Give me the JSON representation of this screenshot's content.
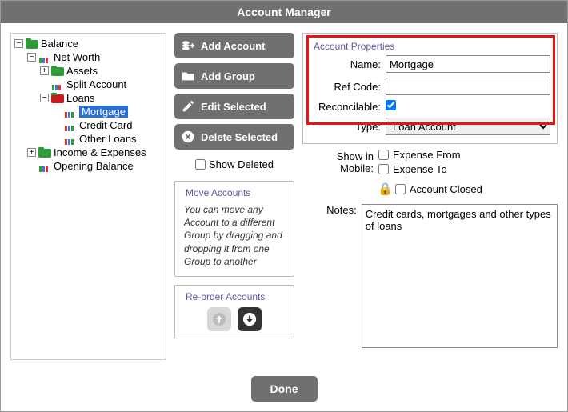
{
  "title": "Account Manager",
  "tree": {
    "root": "Balance",
    "netWorth": "Net Worth",
    "assets": "Assets",
    "splitAccount": "Split Account",
    "loans": "Loans",
    "mortgage": "Mortgage",
    "creditCard": "Credit Card",
    "otherLoans": "Other Loans",
    "incomeExpenses": "Income & Expenses",
    "openingBalance": "Opening Balance"
  },
  "buttons": {
    "addAccount": "Add Account",
    "addGroup": "Add Group",
    "editSelected": "Edit Selected",
    "deleteSelected": "Delete Selected",
    "showDeleted": "Show Deleted",
    "done": "Done"
  },
  "move": {
    "legend": "Move Accounts",
    "text": "You can move any Account to a different Group by dragging and dropping it from one Group to another"
  },
  "reorder": {
    "legend": "Re-order Accounts"
  },
  "props": {
    "legend": "Account Properties",
    "nameLabel": "Name:",
    "nameValue": "Mortgage",
    "refLabel": "Ref Code:",
    "refValue": "",
    "reconcilableLabel": "Reconcilable:",
    "reconcilable": true,
    "typeLabel": "Type:",
    "typeValue": "Loan Account",
    "showMobileLabel": "Show in Mobile:",
    "expenseFrom": "Expense From",
    "expenseTo": "Expense To",
    "closedLabel": "Account Closed",
    "notesLabel": "Notes:",
    "notesValue": "Credit cards, mortgages and other types of loans"
  }
}
